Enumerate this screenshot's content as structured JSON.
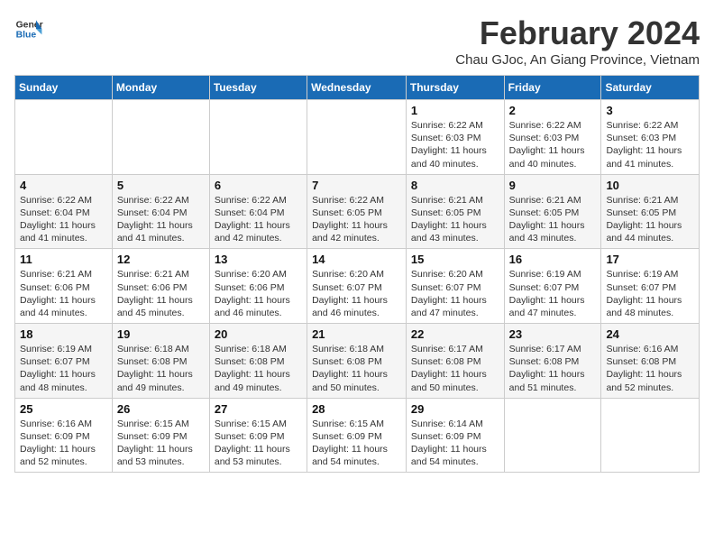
{
  "header": {
    "logo_line1": "General",
    "logo_line2": "Blue",
    "month_title": "February 2024",
    "location": "Chau GJoc, An Giang Province, Vietnam"
  },
  "days_of_week": [
    "Sunday",
    "Monday",
    "Tuesday",
    "Wednesday",
    "Thursday",
    "Friday",
    "Saturday"
  ],
  "weeks": [
    [
      {
        "day": "",
        "sunrise": "",
        "sunset": "",
        "daylight": ""
      },
      {
        "day": "",
        "sunrise": "",
        "sunset": "",
        "daylight": ""
      },
      {
        "day": "",
        "sunrise": "",
        "sunset": "",
        "daylight": ""
      },
      {
        "day": "",
        "sunrise": "",
        "sunset": "",
        "daylight": ""
      },
      {
        "day": "1",
        "sunrise": "Sunrise: 6:22 AM",
        "sunset": "Sunset: 6:03 PM",
        "daylight": "Daylight: 11 hours and 40 minutes."
      },
      {
        "day": "2",
        "sunrise": "Sunrise: 6:22 AM",
        "sunset": "Sunset: 6:03 PM",
        "daylight": "Daylight: 11 hours and 40 minutes."
      },
      {
        "day": "3",
        "sunrise": "Sunrise: 6:22 AM",
        "sunset": "Sunset: 6:03 PM",
        "daylight": "Daylight: 11 hours and 41 minutes."
      }
    ],
    [
      {
        "day": "4",
        "sunrise": "Sunrise: 6:22 AM",
        "sunset": "Sunset: 6:04 PM",
        "daylight": "Daylight: 11 hours and 41 minutes."
      },
      {
        "day": "5",
        "sunrise": "Sunrise: 6:22 AM",
        "sunset": "Sunset: 6:04 PM",
        "daylight": "Daylight: 11 hours and 41 minutes."
      },
      {
        "day": "6",
        "sunrise": "Sunrise: 6:22 AM",
        "sunset": "Sunset: 6:04 PM",
        "daylight": "Daylight: 11 hours and 42 minutes."
      },
      {
        "day": "7",
        "sunrise": "Sunrise: 6:22 AM",
        "sunset": "Sunset: 6:05 PM",
        "daylight": "Daylight: 11 hours and 42 minutes."
      },
      {
        "day": "8",
        "sunrise": "Sunrise: 6:21 AM",
        "sunset": "Sunset: 6:05 PM",
        "daylight": "Daylight: 11 hours and 43 minutes."
      },
      {
        "day": "9",
        "sunrise": "Sunrise: 6:21 AM",
        "sunset": "Sunset: 6:05 PM",
        "daylight": "Daylight: 11 hours and 43 minutes."
      },
      {
        "day": "10",
        "sunrise": "Sunrise: 6:21 AM",
        "sunset": "Sunset: 6:05 PM",
        "daylight": "Daylight: 11 hours and 44 minutes."
      }
    ],
    [
      {
        "day": "11",
        "sunrise": "Sunrise: 6:21 AM",
        "sunset": "Sunset: 6:06 PM",
        "daylight": "Daylight: 11 hours and 44 minutes."
      },
      {
        "day": "12",
        "sunrise": "Sunrise: 6:21 AM",
        "sunset": "Sunset: 6:06 PM",
        "daylight": "Daylight: 11 hours and 45 minutes."
      },
      {
        "day": "13",
        "sunrise": "Sunrise: 6:20 AM",
        "sunset": "Sunset: 6:06 PM",
        "daylight": "Daylight: 11 hours and 46 minutes."
      },
      {
        "day": "14",
        "sunrise": "Sunrise: 6:20 AM",
        "sunset": "Sunset: 6:07 PM",
        "daylight": "Daylight: 11 hours and 46 minutes."
      },
      {
        "day": "15",
        "sunrise": "Sunrise: 6:20 AM",
        "sunset": "Sunset: 6:07 PM",
        "daylight": "Daylight: 11 hours and 47 minutes."
      },
      {
        "day": "16",
        "sunrise": "Sunrise: 6:19 AM",
        "sunset": "Sunset: 6:07 PM",
        "daylight": "Daylight: 11 hours and 47 minutes."
      },
      {
        "day": "17",
        "sunrise": "Sunrise: 6:19 AM",
        "sunset": "Sunset: 6:07 PM",
        "daylight": "Daylight: 11 hours and 48 minutes."
      }
    ],
    [
      {
        "day": "18",
        "sunrise": "Sunrise: 6:19 AM",
        "sunset": "Sunset: 6:07 PM",
        "daylight": "Daylight: 11 hours and 48 minutes."
      },
      {
        "day": "19",
        "sunrise": "Sunrise: 6:18 AM",
        "sunset": "Sunset: 6:08 PM",
        "daylight": "Daylight: 11 hours and 49 minutes."
      },
      {
        "day": "20",
        "sunrise": "Sunrise: 6:18 AM",
        "sunset": "Sunset: 6:08 PM",
        "daylight": "Daylight: 11 hours and 49 minutes."
      },
      {
        "day": "21",
        "sunrise": "Sunrise: 6:18 AM",
        "sunset": "Sunset: 6:08 PM",
        "daylight": "Daylight: 11 hours and 50 minutes."
      },
      {
        "day": "22",
        "sunrise": "Sunrise: 6:17 AM",
        "sunset": "Sunset: 6:08 PM",
        "daylight": "Daylight: 11 hours and 50 minutes."
      },
      {
        "day": "23",
        "sunrise": "Sunrise: 6:17 AM",
        "sunset": "Sunset: 6:08 PM",
        "daylight": "Daylight: 11 hours and 51 minutes."
      },
      {
        "day": "24",
        "sunrise": "Sunrise: 6:16 AM",
        "sunset": "Sunset: 6:08 PM",
        "daylight": "Daylight: 11 hours and 52 minutes."
      }
    ],
    [
      {
        "day": "25",
        "sunrise": "Sunrise: 6:16 AM",
        "sunset": "Sunset: 6:09 PM",
        "daylight": "Daylight: 11 hours and 52 minutes."
      },
      {
        "day": "26",
        "sunrise": "Sunrise: 6:15 AM",
        "sunset": "Sunset: 6:09 PM",
        "daylight": "Daylight: 11 hours and 53 minutes."
      },
      {
        "day": "27",
        "sunrise": "Sunrise: 6:15 AM",
        "sunset": "Sunset: 6:09 PM",
        "daylight": "Daylight: 11 hours and 53 minutes."
      },
      {
        "day": "28",
        "sunrise": "Sunrise: 6:15 AM",
        "sunset": "Sunset: 6:09 PM",
        "daylight": "Daylight: 11 hours and 54 minutes."
      },
      {
        "day": "29",
        "sunrise": "Sunrise: 6:14 AM",
        "sunset": "Sunset: 6:09 PM",
        "daylight": "Daylight: 11 hours and 54 minutes."
      },
      {
        "day": "",
        "sunrise": "",
        "sunset": "",
        "daylight": ""
      },
      {
        "day": "",
        "sunrise": "",
        "sunset": "",
        "daylight": ""
      }
    ]
  ]
}
